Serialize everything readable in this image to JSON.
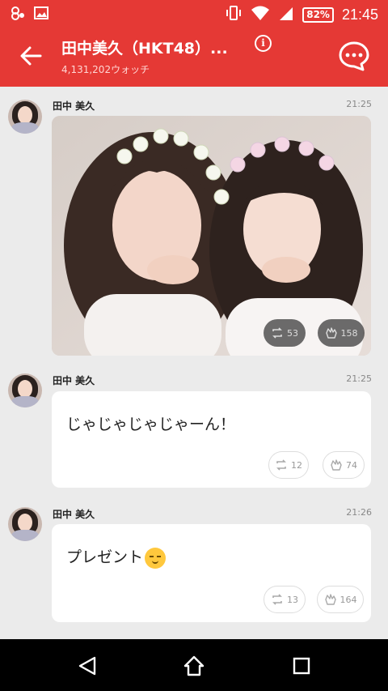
{
  "status_bar": {
    "battery": "82%",
    "time": "21:45",
    "icons": [
      "notification-icon",
      "image-icon",
      "vibrate-icon",
      "wifi-icon",
      "signal-icon",
      "battery-icon"
    ]
  },
  "header": {
    "title": "田中美久（HKT48）...",
    "watch_count": "4,131,202ウォッチ",
    "info_label": "i",
    "color": "#e53935"
  },
  "posts": [
    {
      "author": "田中 美久",
      "time": "21:25",
      "type": "photo",
      "photo_description": "two girls with flower crowns",
      "retweets": "53",
      "claps": "158"
    },
    {
      "author": "田中 美久",
      "time": "21:25",
      "type": "text",
      "text": "じゃじゃじゃじゃーん！",
      "retweets": "12",
      "claps": "74"
    },
    {
      "author": "田中 美久",
      "time": "21:26",
      "type": "text",
      "text": "プレゼント",
      "emoji": "smiling-face-emoji",
      "retweets": "13",
      "claps": "164"
    }
  ]
}
